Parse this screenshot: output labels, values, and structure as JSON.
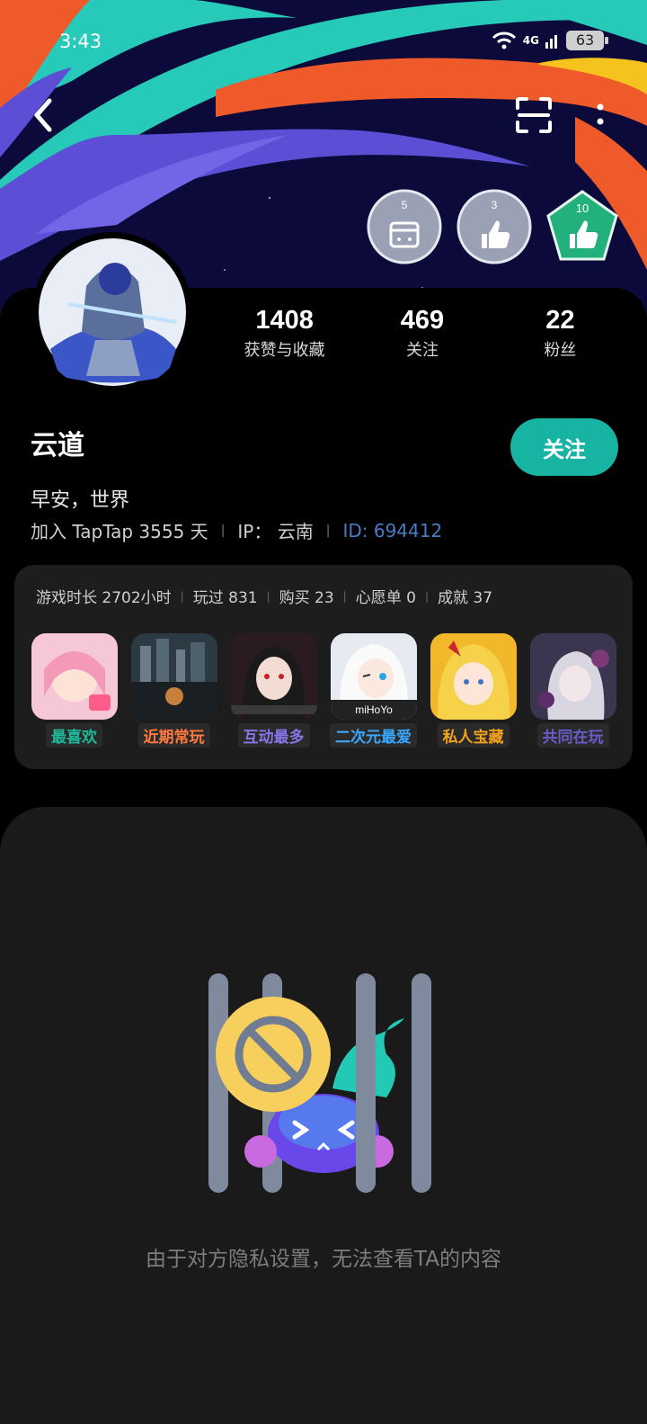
{
  "status_bar": {
    "time": "3:43",
    "network": "4G",
    "battery": "63"
  },
  "header": {
    "back_icon": "chevron-left-icon",
    "scan_icon": "scan-icon",
    "more_icon": "more-vertical-icon"
  },
  "badges": [
    {
      "count": "5",
      "icon": "calendar-gamepad-icon",
      "color": "#9aa1b5"
    },
    {
      "count": "3",
      "icon": "thumbs-up-icon",
      "color": "#9aa1b5"
    },
    {
      "count": "10",
      "icon": "thumbs-up-icon",
      "color": "#22b07d"
    }
  ],
  "profile": {
    "name": "云道",
    "follow_label": "关注",
    "bio": "早安，世界",
    "joined": "加入 TapTap 3555 天",
    "ip": "IP： 云南",
    "id": "ID: 694412"
  },
  "stats": [
    {
      "value": "1408",
      "label": "获赞与收藏"
    },
    {
      "value": "469",
      "label": "关注"
    },
    {
      "value": "22",
      "label": "粉丝"
    }
  ],
  "summary": [
    "游戏时长 2702小时",
    "玩过 831",
    "购买 23",
    "心愿单 0",
    "成就 37"
  ],
  "games": [
    {
      "tag": "最喜欢",
      "color": "#1fb89a",
      "thumb": "pink-anime-girl"
    },
    {
      "tag": "近期常玩",
      "color": "#ff7a3d",
      "thumb": "city-night"
    },
    {
      "tag": "互动最多",
      "color": "#8a74e8",
      "thumb": "dark-hair-girl"
    },
    {
      "tag": "二次元最爱",
      "color": "#3aa8ff",
      "thumb": "white-hair-girl",
      "overlay": "miHoYo"
    },
    {
      "tag": "私人宝藏",
      "color": "#f3a21c",
      "thumb": "blonde-girl"
    },
    {
      "tag": "共同在玩",
      "color": "#6a5cc8",
      "thumb": "rose-girl"
    }
  ],
  "privacy": {
    "message": "由于对方隐私设置，无法查看TA的内容",
    "icon": "privacy-blocked-icon"
  },
  "colors": {
    "accent": "#17b3a3",
    "id_link": "#4a7cc4"
  }
}
